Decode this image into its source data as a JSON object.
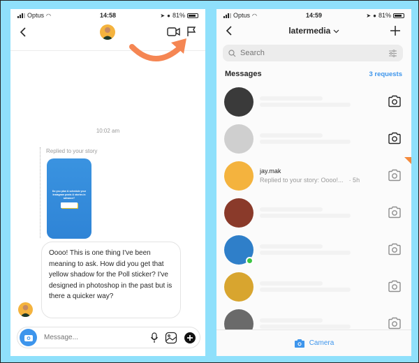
{
  "left_screen": {
    "status_bar": {
      "carrier": "Optus",
      "time": "14:58",
      "battery": "81%"
    },
    "header": {
      "back_icon": "chevron-left-icon",
      "avatar": "user-avatar",
      "video_icon": "video-camera-icon",
      "flag_icon": "flag-icon"
    },
    "annotation": {
      "arrow_color": "#f58653",
      "arrow_icon": "curved-arrow-icon"
    },
    "conversation": {
      "timestamp": "10:02 am",
      "replied_label": "Replied to your story",
      "story_card": {
        "text": "Do you plan & schedule your Instagram posts & stories in advance?",
        "poll_option_1": "YES",
        "poll_option_2": "NO",
        "color": "#3a93e0"
      },
      "message_text": "Oooo! This is one thing I've been meaning to ask. How did you get that yellow shadow for the Poll sticker? I've designed in photoshop in the past but is there a quicker way?"
    },
    "composer": {
      "placeholder": "Message...",
      "camera_icon": "camera-icon",
      "mic_icon": "microphone-icon",
      "gallery_icon": "image-icon",
      "plus_icon": "plus-circle-icon"
    }
  },
  "right_screen": {
    "status_bar": {
      "carrier": "Optus",
      "time": "14:59",
      "battery": "81%"
    },
    "header": {
      "title": "latermedia",
      "dropdown_icon": "chevron-down-icon",
      "back_icon": "chevron-left-icon",
      "new_message_icon": "plus-icon"
    },
    "search": {
      "placeholder": "Search",
      "filter_icon": "sliders-icon"
    },
    "messages_section": {
      "title": "Messages",
      "requests": "3 requests"
    },
    "threads": [
      {
        "name": "",
        "preview": "",
        "time": "",
        "blurred": true,
        "avatar_color": "#3a3a3a",
        "online": false,
        "unread_flag": false
      },
      {
        "name": "",
        "preview": "",
        "time": "",
        "blurred": true,
        "avatar_color": "#cfcfcf",
        "online": false,
        "unread_flag": false
      },
      {
        "name": "jay.mak",
        "preview": "Replied to your story: Oooo!...",
        "time": "· 5h",
        "blurred": false,
        "avatar_color": "#f4b33e",
        "online": false,
        "unread_flag": true
      },
      {
        "name": "",
        "preview": "",
        "time": "",
        "blurred": true,
        "avatar_color": "#8a3a2a",
        "online": false,
        "unread_flag": false
      },
      {
        "name": "",
        "preview": "",
        "time": "",
        "blurred": true,
        "avatar_color": "#2f7fc9",
        "online": true,
        "unread_flag": false
      },
      {
        "name": "",
        "preview": "",
        "time": "",
        "blurred": true,
        "avatar_color": "#d8a52f",
        "online": false,
        "unread_flag": false
      },
      {
        "name": "",
        "preview": "",
        "time": "",
        "blurred": true,
        "avatar_color": "#6a6a6a",
        "online": false,
        "unread_flag": false
      }
    ],
    "bottom_bar": {
      "label": "Camera",
      "icon": "camera-icon"
    }
  },
  "colors": {
    "background": "#8fe0fb",
    "accent_blue": "#3d95ec",
    "online_green": "#3cc443",
    "annotation_orange": "#f58653"
  }
}
